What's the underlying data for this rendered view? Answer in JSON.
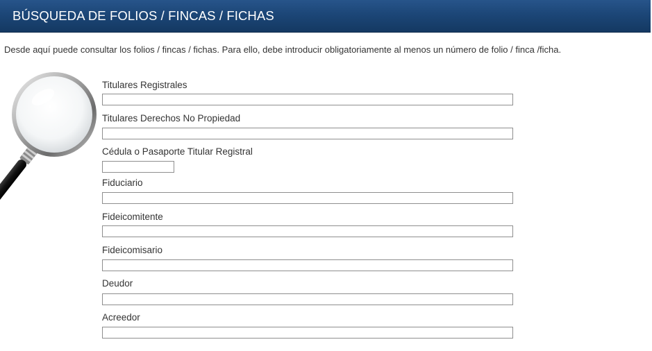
{
  "header": {
    "title": "BÚSQUEDA DE FOLIOS / FINCAS / FICHAS"
  },
  "intro": "Desde aquí puede consultar los folios / fincas / fichas. Para ello, debe introducir obligatoriamente al menos un número de folio / finca /ficha.",
  "form": {
    "fields": [
      {
        "label": "Titulares Registrales",
        "value": ""
      },
      {
        "label": "Titulares Derechos No Propiedad",
        "value": ""
      },
      {
        "label": "Cédula o Pasaporte Titular Registral",
        "value": ""
      },
      {
        "label": "Fiduciario",
        "value": ""
      },
      {
        "label": "Fideicomitente",
        "value": ""
      },
      {
        "label": "Fideicomisario",
        "value": ""
      },
      {
        "label": "Deudor",
        "value": ""
      },
      {
        "label": "Acreedor",
        "value": ""
      }
    ]
  },
  "icons": {
    "illustration": "magnifying-glass-icon"
  },
  "colors": {
    "header": "#1c4677",
    "text": "#333333",
    "input_border": "#8e8e8e"
  }
}
